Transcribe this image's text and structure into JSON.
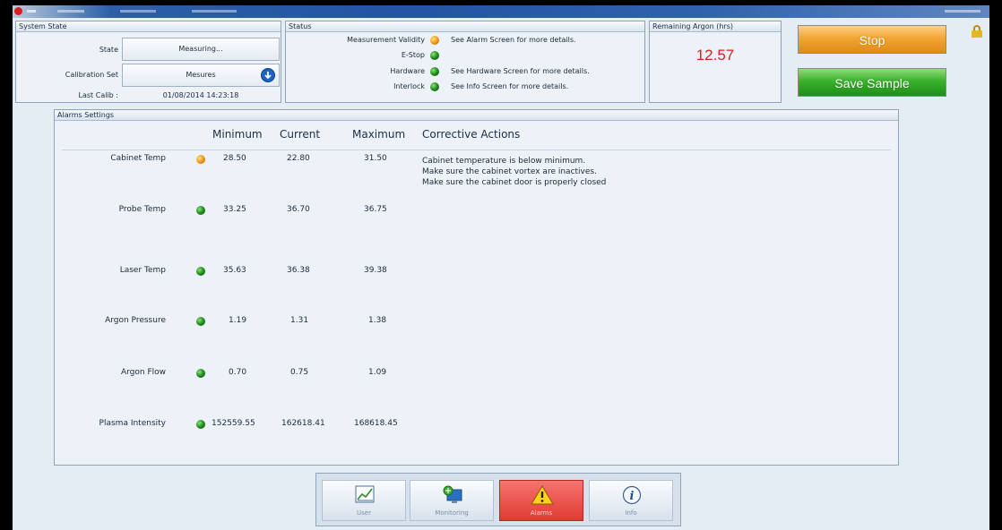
{
  "system_state": {
    "title": "System State",
    "state_label": "State",
    "state_value": "Measuring...",
    "calibration_label": "Calibration Set",
    "calibration_value": "Mesures",
    "last_calib_label": "Last Calib :",
    "last_calib_value": "01/08/2014 14:23:18"
  },
  "status": {
    "title": "Status",
    "rows": [
      {
        "label": "Measurement Validity",
        "status": "orange",
        "message": "See Alarm Screen for more details."
      },
      {
        "label": "E-Stop",
        "status": "green",
        "message": ""
      },
      {
        "label": "Hardware",
        "status": "green",
        "message": "See Hardware Screen for more details."
      },
      {
        "label": "Interlock",
        "status": "green",
        "message": "See Info Screen for more details."
      }
    ]
  },
  "argon": {
    "title": "Remaining Argon (hrs)",
    "value": "12.57"
  },
  "buttons": {
    "stop_label": "Stop",
    "save_label": "Save Sample"
  },
  "alarms": {
    "title": "Alarms Settings",
    "columns": {
      "minimum": "Minimum",
      "current": "Current",
      "maximum": "Maximum",
      "actions": "Corrective Actions"
    },
    "rows": [
      {
        "name": "Cabinet Temp",
        "status": "orange",
        "min": "28.50",
        "current": "22.80",
        "max": "31.50"
      },
      {
        "name": "Probe Temp",
        "status": "green",
        "min": "33.25",
        "current": "36.70",
        "max": "36.75"
      },
      {
        "name": "Laser Temp",
        "status": "green",
        "min": "35.63",
        "current": "36.38",
        "max": "39.38"
      },
      {
        "name": "Argon Pressure",
        "status": "green",
        "min": "1.19",
        "current": "1.31",
        "max": "1.38"
      },
      {
        "name": "Argon Flow",
        "status": "green",
        "min": "0.70",
        "current": "0.75",
        "max": "1.09"
      },
      {
        "name": "Plasma Intensity",
        "status": "green",
        "min": "152559.55",
        "current": "162618.41",
        "max": "168618.45"
      }
    ],
    "corrective_actions": [
      "Cabinet temperature is below minimum.",
      "Make sure the cabinet vortex are inactives.",
      "Make sure the cabinet door is properly closed"
    ]
  },
  "nav": {
    "tabs": [
      {
        "label": "User",
        "icon": "chart-icon",
        "active": false
      },
      {
        "label": "Monitoring",
        "icon": "monitoring-icon",
        "active": false
      },
      {
        "label": "Alarms",
        "icon": "warning-icon",
        "active": true
      },
      {
        "label": "Info",
        "icon": "info-icon",
        "active": false
      }
    ]
  },
  "colors": {
    "ok": "#1f8c1c",
    "warning": "#f2911a",
    "argon_value": "#d82020",
    "stop": "#f3a532",
    "save": "#3ab22c",
    "active_tab": "#e23b33"
  }
}
